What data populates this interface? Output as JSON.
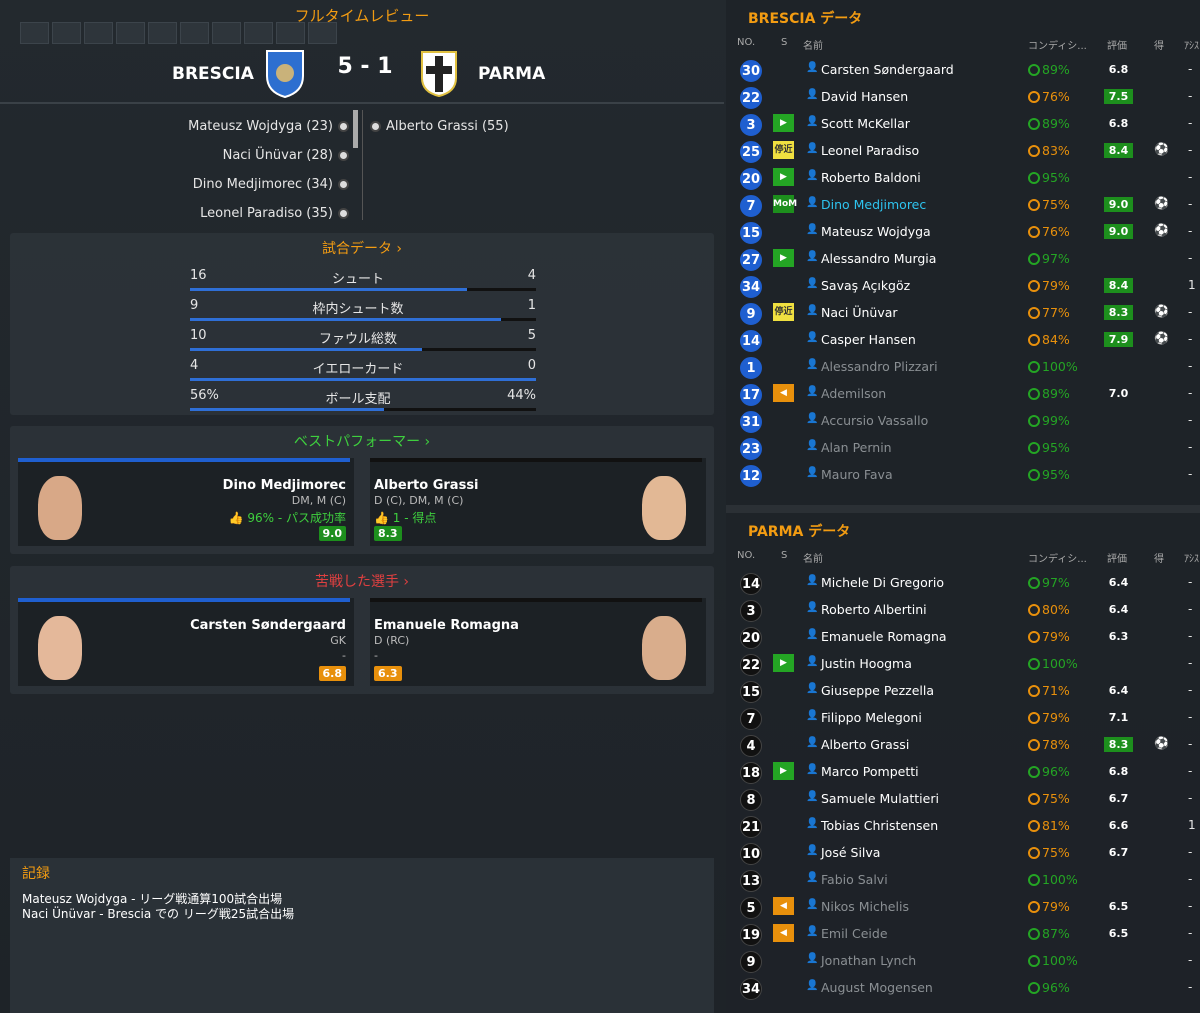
{
  "header": {
    "title": "フルタイムレビュー",
    "home": "BRESCIA",
    "away": "PARMA",
    "score": "5 - 1"
  },
  "scorers": {
    "home": [
      "Mateusz Wojdyga (23)",
      "Naci Ünüvar (28)",
      "Dino Medjimorec (34)",
      "Leonel Paradiso (35)"
    ],
    "away": [
      "Alberto Grassi (55)"
    ]
  },
  "match_stats": {
    "title": "試合データ ›",
    "rows": [
      {
        "label": "シュート",
        "home": "16",
        "away": "4",
        "home_share": 0.8
      },
      {
        "label": "枠内シュート数",
        "home": "9",
        "away": "1",
        "home_share": 0.9
      },
      {
        "label": "ファウル総数",
        "home": "10",
        "away": "5",
        "home_share": 0.67
      },
      {
        "label": "イエローカード",
        "home": "4",
        "away": "0",
        "home_share": 1.0
      },
      {
        "label": "ボール支配",
        "home": "56%",
        "away": "44%",
        "home_share": 0.56
      }
    ]
  },
  "best": {
    "title": "ベストパフォーマー ›",
    "home": {
      "name": "Dino Medjimorec",
      "pos": "DM, M (C)",
      "perf": "96% - パス成功率",
      "rating": "9.0"
    },
    "away": {
      "name": "Alberto Grassi",
      "pos": "D (C), DM, M (C)",
      "perf": "1 - 得点",
      "rating": "8.3"
    }
  },
  "worst": {
    "title": "苦戦した選手 ›",
    "home": {
      "name": "Carsten Søndergaard",
      "pos": "GK",
      "perf": "-",
      "rating": "6.8"
    },
    "away": {
      "name": "Emanuele Romagna",
      "pos": "D (RC)",
      "perf": "-",
      "rating": "6.3"
    }
  },
  "records": {
    "title": "記録",
    "lines": [
      "Mateusz Wojdyga - リーグ戦通算100試合出場",
      "Naci Ünüvar - Brescia での リーグ戦25試合出場"
    ]
  },
  "columns": {
    "no": "NO.",
    "s": "S",
    "name": "名前",
    "cond": "コンディシ...",
    "rating": "評価",
    "goals": "得",
    "assists": "ｱｼｽ"
  },
  "brescia": {
    "title": "BRESCIA データ",
    "players": [
      {
        "no": "30",
        "sub": "",
        "name": "Carsten Søndergaard",
        "cond": "89%",
        "rating": "6.8",
        "goal": "",
        "ast": "-"
      },
      {
        "no": "22",
        "sub": "",
        "name": "David Hansen",
        "cond": "76%",
        "rating": "7.5",
        "goal": "",
        "ast": "-"
      },
      {
        "no": "3",
        "sub": "in",
        "name": "Scott McKellar",
        "cond": "89%",
        "rating": "6.8",
        "goal": "",
        "ast": "-"
      },
      {
        "no": "25",
        "sub": "停近",
        "name": "Leonel Paradiso",
        "cond": "83%",
        "rating": "8.4",
        "goal": "⚽",
        "ast": "-"
      },
      {
        "no": "20",
        "sub": "in",
        "name": "Roberto Baldoni",
        "cond": "95%",
        "rating": "",
        "goal": "",
        "ast": "-"
      },
      {
        "no": "7",
        "sub": "MoM",
        "name": "Dino Medjimorec",
        "cond": "75%",
        "rating": "9.0",
        "goal": "⚽",
        "ast": "-"
      },
      {
        "no": "15",
        "sub": "",
        "name": "Mateusz Wojdyga",
        "cond": "76%",
        "rating": "9.0",
        "goal": "⚽",
        "ast": "-"
      },
      {
        "no": "27",
        "sub": "in",
        "name": "Alessandro Murgia",
        "cond": "97%",
        "rating": "",
        "goal": "",
        "ast": "-"
      },
      {
        "no": "34",
        "sub": "",
        "name": "Savaş Açıkgöz",
        "cond": "79%",
        "rating": "8.4",
        "goal": "",
        "ast": "1"
      },
      {
        "no": "9",
        "sub": "停近",
        "name": "Naci Ünüvar",
        "cond": "77%",
        "rating": "8.3",
        "goal": "⚽",
        "ast": "-"
      },
      {
        "no": "14",
        "sub": "",
        "name": "Casper Hansen",
        "cond": "84%",
        "rating": "7.9",
        "goal": "⚽",
        "ast": "-"
      },
      {
        "no": "1",
        "sub": "",
        "name": "Alessandro Plizzari",
        "cond": "100%",
        "rating": "",
        "goal": "",
        "ast": "-"
      },
      {
        "no": "17",
        "sub": "out",
        "name": "Ademilson",
        "cond": "89%",
        "rating": "7.0",
        "goal": "",
        "ast": "-"
      },
      {
        "no": "31",
        "sub": "",
        "name": "Accursio Vassallo",
        "cond": "99%",
        "rating": "",
        "goal": "",
        "ast": "-"
      },
      {
        "no": "23",
        "sub": "",
        "name": "Alan Pernin",
        "cond": "95%",
        "rating": "",
        "goal": "",
        "ast": "-"
      },
      {
        "no": "12",
        "sub": "",
        "name": "Mauro Fava",
        "cond": "95%",
        "rating": "",
        "goal": "",
        "ast": "-"
      }
    ]
  },
  "parma": {
    "title": "PARMA データ",
    "players": [
      {
        "no": "14",
        "sub": "",
        "name": "Michele Di Gregorio",
        "cond": "97%",
        "rating": "6.4",
        "goal": "",
        "ast": "-"
      },
      {
        "no": "3",
        "sub": "",
        "name": "Roberto Albertini",
        "cond": "80%",
        "rating": "6.4",
        "goal": "",
        "ast": "-"
      },
      {
        "no": "20",
        "sub": "",
        "name": "Emanuele Romagna",
        "cond": "79%",
        "rating": "6.3",
        "goal": "",
        "ast": "-"
      },
      {
        "no": "22",
        "sub": "in",
        "name": "Justin Hoogma",
        "cond": "100%",
        "rating": "",
        "goal": "",
        "ast": "-"
      },
      {
        "no": "15",
        "sub": "",
        "name": "Giuseppe Pezzella",
        "cond": "71%",
        "rating": "6.4",
        "goal": "",
        "ast": "-"
      },
      {
        "no": "7",
        "sub": "",
        "name": "Filippo Melegoni",
        "cond": "79%",
        "rating": "7.1",
        "goal": "",
        "ast": "-"
      },
      {
        "no": "4",
        "sub": "",
        "name": "Alberto Grassi",
        "cond": "78%",
        "rating": "8.3",
        "goal": "⚽",
        "ast": "-"
      },
      {
        "no": "18",
        "sub": "in",
        "name": "Marco Pompetti",
        "cond": "96%",
        "rating": "6.8",
        "goal": "",
        "ast": "-"
      },
      {
        "no": "8",
        "sub": "",
        "name": "Samuele Mulattieri",
        "cond": "75%",
        "rating": "6.7",
        "goal": "",
        "ast": "-"
      },
      {
        "no": "21",
        "sub": "",
        "name": "Tobias Christensen",
        "cond": "81%",
        "rating": "6.6",
        "goal": "",
        "ast": "1"
      },
      {
        "no": "10",
        "sub": "",
        "name": "José Silva",
        "cond": "75%",
        "rating": "6.7",
        "goal": "",
        "ast": "-"
      },
      {
        "no": "13",
        "sub": "",
        "name": "Fabio Salvi",
        "cond": "100%",
        "rating": "",
        "goal": "",
        "ast": "-"
      },
      {
        "no": "5",
        "sub": "out",
        "name": "Nikos Michelis",
        "cond": "79%",
        "rating": "6.5",
        "goal": "",
        "ast": "-"
      },
      {
        "no": "19",
        "sub": "out",
        "name": "Emil Ceide",
        "cond": "87%",
        "rating": "6.5",
        "goal": "",
        "ast": "-"
      },
      {
        "no": "9",
        "sub": "",
        "name": "Jonathan Lynch",
        "cond": "100%",
        "rating": "",
        "goal": "",
        "ast": "-"
      },
      {
        "no": "34",
        "sub": "",
        "name": "August Mogensen",
        "cond": "96%",
        "rating": "",
        "goal": "",
        "ast": "-"
      }
    ]
  },
  "colors": {
    "accent": "#f39c12",
    "home_blue": "#1f5fd0",
    "green": "#24a524",
    "rating_green": "#1d8f1d",
    "orange": "#e8900c"
  }
}
